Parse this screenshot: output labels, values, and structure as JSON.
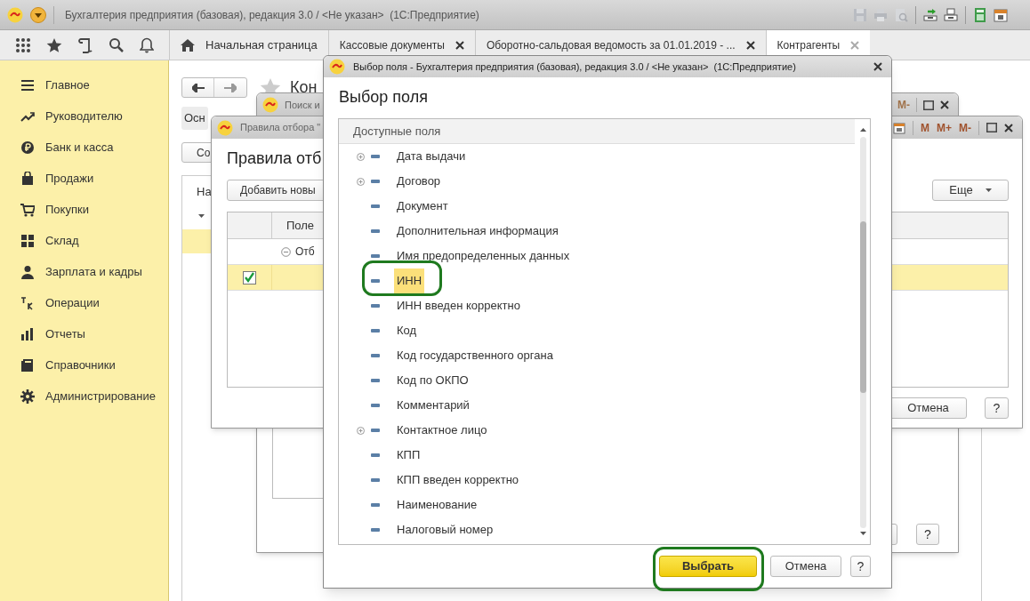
{
  "app": {
    "title": "Бухгалтерия предприятия (базовая), редакция 3.0 / <Не указан>  (1С:Предприятие)"
  },
  "tabs": [
    {
      "label": "Начальная страница",
      "kind": "home",
      "selected": false
    },
    {
      "label": "Кассовые документы",
      "kind": "page",
      "selected": false
    },
    {
      "label": "Оборотно-сальдовая ведомость за 01.01.2019 - ...",
      "kind": "page",
      "selected": false
    },
    {
      "label": "Контрагенты",
      "kind": "page",
      "selected": true
    }
  ],
  "sidebar": {
    "items": [
      "Главное",
      "Руководителю",
      "Банк и касса",
      "Продажи",
      "Покупки",
      "Склад",
      "Зарплата и кадры",
      "Операции",
      "Отчеты",
      "Справочники",
      "Администрирование"
    ]
  },
  "form": {
    "title": "Кон",
    "tab": "Осн",
    "create_button": "Со",
    "column": "На"
  },
  "search_window": {
    "title": "Поиск и",
    "memory_button": "M-",
    "help_button": "?"
  },
  "filter_window": {
    "title": "Правила отбора \"",
    "heading": "Правила отб",
    "add_button": "Добавить новы",
    "memory_buttons": [
      "M",
      "M+",
      "M-"
    ],
    "more_button": "Еще",
    "column": "Поле",
    "group_row": {
      "label": "Отб",
      "expanded": true
    },
    "rows": [
      {
        "checked": true
      }
    ],
    "cancel_button": "Отмена",
    "help_button": "?"
  },
  "dialog": {
    "title": "Выбор поля - Бухгалтерия предприятия (базовая), редакция 3.0 / <Не указан>  (1С:Предприятие)",
    "heading": "Выбор поля",
    "list_header": "Доступные поля",
    "items": [
      {
        "label": "Дата выдачи",
        "expandable": true,
        "selected": false
      },
      {
        "label": "Договор",
        "expandable": true,
        "selected": false
      },
      {
        "label": "Документ",
        "expandable": false,
        "selected": false
      },
      {
        "label": "Дополнительная информация",
        "expandable": false,
        "selected": false
      },
      {
        "label": "Имя предопределенных данных",
        "expandable": false,
        "selected": false
      },
      {
        "label": "ИНН",
        "expandable": false,
        "selected": true
      },
      {
        "label": "ИНН введен корректно",
        "expandable": false,
        "selected": false
      },
      {
        "label": "Код",
        "expandable": false,
        "selected": false
      },
      {
        "label": "Код государственного органа",
        "expandable": false,
        "selected": false
      },
      {
        "label": "Код по ОКПО",
        "expandable": false,
        "selected": false
      },
      {
        "label": "Комментарий",
        "expandable": false,
        "selected": false
      },
      {
        "label": "Контактное лицо",
        "expandable": true,
        "selected": false
      },
      {
        "label": "КПП",
        "expandable": false,
        "selected": false
      },
      {
        "label": "КПП введен корректно",
        "expandable": false,
        "selected": false
      },
      {
        "label": "Наименование",
        "expandable": false,
        "selected": false
      },
      {
        "label": "Налоговый номер",
        "expandable": false,
        "selected": false
      }
    ],
    "select_button": "Выбрать",
    "cancel_button": "Отмена",
    "help_button": "?"
  }
}
